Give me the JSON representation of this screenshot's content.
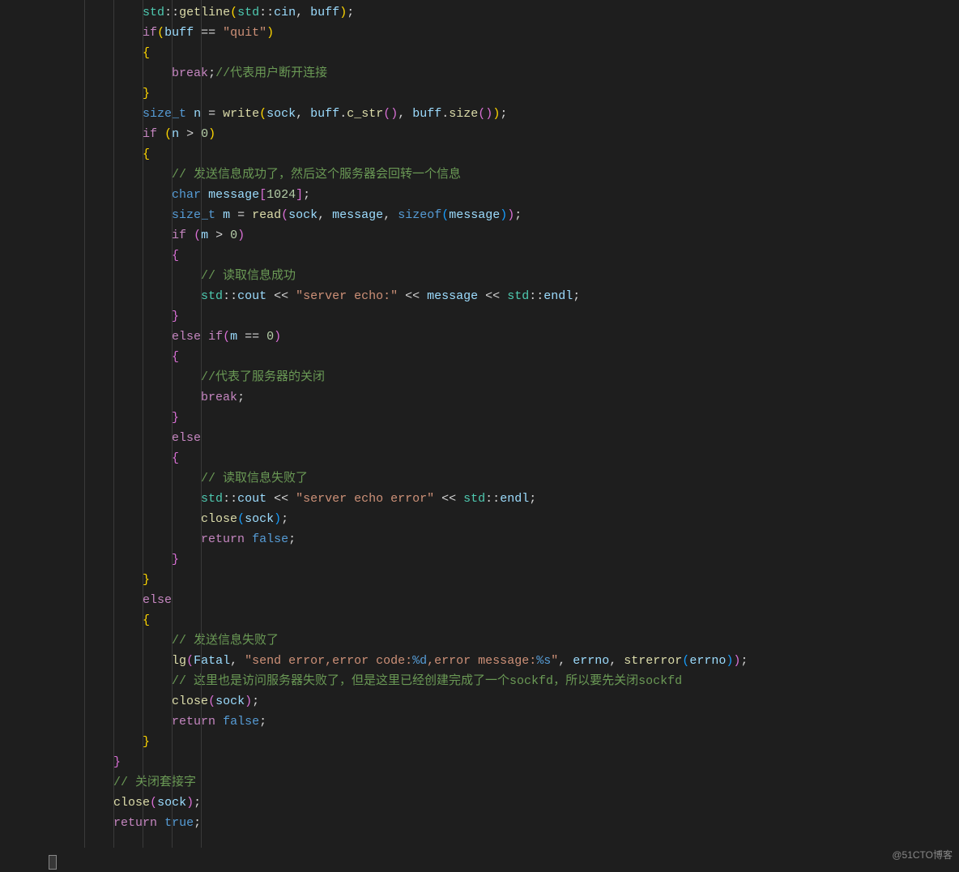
{
  "watermark": "@51CTO博客",
  "code": {
    "lines": [
      {
        "indent": 3,
        "tokens": [
          {
            "t": "namespace",
            "v": "std"
          },
          {
            "t": "operator",
            "v": "::"
          },
          {
            "t": "func",
            "v": "getline"
          },
          {
            "t": "paren-y",
            "v": "("
          },
          {
            "t": "namespace",
            "v": "std"
          },
          {
            "t": "operator",
            "v": "::"
          },
          {
            "t": "var",
            "v": "cin"
          },
          {
            "t": "operator",
            "v": ", "
          },
          {
            "t": "var",
            "v": "buff"
          },
          {
            "t": "paren-y",
            "v": ")"
          },
          {
            "t": "operator",
            "v": ";"
          }
        ]
      },
      {
        "indent": 3,
        "tokens": [
          {
            "t": "keyword",
            "v": "if"
          },
          {
            "t": "paren-y",
            "v": "("
          },
          {
            "t": "var",
            "v": "buff"
          },
          {
            "t": "operator",
            "v": " == "
          },
          {
            "t": "string",
            "v": "\"quit\""
          },
          {
            "t": "paren-y",
            "v": ")"
          }
        ]
      },
      {
        "indent": 3,
        "tokens": [
          {
            "t": "paren-y",
            "v": "{"
          }
        ]
      },
      {
        "indent": 4,
        "tokens": [
          {
            "t": "keyword",
            "v": "break"
          },
          {
            "t": "operator",
            "v": ";"
          },
          {
            "t": "comment",
            "v": "//代表用户断开连接"
          }
        ]
      },
      {
        "indent": 3,
        "tokens": [
          {
            "t": "paren-y",
            "v": "}"
          }
        ]
      },
      {
        "indent": 3,
        "tokens": [
          {
            "t": "type",
            "v": "size_t"
          },
          {
            "t": "operator",
            "v": " "
          },
          {
            "t": "var",
            "v": "n"
          },
          {
            "t": "operator",
            "v": " = "
          },
          {
            "t": "func",
            "v": "write"
          },
          {
            "t": "paren-y",
            "v": "("
          },
          {
            "t": "var",
            "v": "sock"
          },
          {
            "t": "operator",
            "v": ", "
          },
          {
            "t": "var",
            "v": "buff"
          },
          {
            "t": "operator",
            "v": "."
          },
          {
            "t": "func",
            "v": "c_str"
          },
          {
            "t": "paren-m",
            "v": "()"
          },
          {
            "t": "operator",
            "v": ", "
          },
          {
            "t": "var",
            "v": "buff"
          },
          {
            "t": "operator",
            "v": "."
          },
          {
            "t": "func",
            "v": "size"
          },
          {
            "t": "paren-m",
            "v": "()"
          },
          {
            "t": "paren-y",
            "v": ")"
          },
          {
            "t": "operator",
            "v": ";"
          }
        ]
      },
      {
        "indent": 3,
        "tokens": [
          {
            "t": "keyword",
            "v": "if"
          },
          {
            "t": "operator",
            "v": " "
          },
          {
            "t": "paren-y",
            "v": "("
          },
          {
            "t": "var",
            "v": "n"
          },
          {
            "t": "operator",
            "v": " > "
          },
          {
            "t": "number",
            "v": "0"
          },
          {
            "t": "paren-y",
            "v": ")"
          }
        ]
      },
      {
        "indent": 3,
        "tokens": [
          {
            "t": "paren-y",
            "v": "{"
          }
        ]
      },
      {
        "indent": 4,
        "tokens": [
          {
            "t": "comment",
            "v": "// 发送信息成功了，然后这个服务器会回转一个信息"
          }
        ]
      },
      {
        "indent": 4,
        "tokens": [
          {
            "t": "type",
            "v": "char"
          },
          {
            "t": "operator",
            "v": " "
          },
          {
            "t": "var",
            "v": "message"
          },
          {
            "t": "paren-m",
            "v": "["
          },
          {
            "t": "number",
            "v": "1024"
          },
          {
            "t": "paren-m",
            "v": "]"
          },
          {
            "t": "operator",
            "v": ";"
          }
        ]
      },
      {
        "indent": 4,
        "tokens": [
          {
            "t": "type",
            "v": "size_t"
          },
          {
            "t": "operator",
            "v": " "
          },
          {
            "t": "var",
            "v": "m"
          },
          {
            "t": "operator",
            "v": " = "
          },
          {
            "t": "func",
            "v": "read"
          },
          {
            "t": "paren-m",
            "v": "("
          },
          {
            "t": "var",
            "v": "sock"
          },
          {
            "t": "operator",
            "v": ", "
          },
          {
            "t": "var",
            "v": "message"
          },
          {
            "t": "operator",
            "v": ", "
          },
          {
            "t": "type",
            "v": "sizeof"
          },
          {
            "t": "paren-b",
            "v": "("
          },
          {
            "t": "var",
            "v": "message"
          },
          {
            "t": "paren-b",
            "v": ")"
          },
          {
            "t": "paren-m",
            "v": ")"
          },
          {
            "t": "operator",
            "v": ";"
          }
        ]
      },
      {
        "indent": 4,
        "tokens": [
          {
            "t": "keyword",
            "v": "if"
          },
          {
            "t": "operator",
            "v": " "
          },
          {
            "t": "paren-m",
            "v": "("
          },
          {
            "t": "var",
            "v": "m"
          },
          {
            "t": "operator",
            "v": " > "
          },
          {
            "t": "number",
            "v": "0"
          },
          {
            "t": "paren-m",
            "v": ")"
          }
        ]
      },
      {
        "indent": 4,
        "tokens": [
          {
            "t": "paren-m",
            "v": "{"
          }
        ]
      },
      {
        "indent": 5,
        "tokens": [
          {
            "t": "comment",
            "v": "// 读取信息成功"
          }
        ]
      },
      {
        "indent": 5,
        "tokens": [
          {
            "t": "namespace",
            "v": "std"
          },
          {
            "t": "operator",
            "v": "::"
          },
          {
            "t": "var",
            "v": "cout"
          },
          {
            "t": "operator",
            "v": " << "
          },
          {
            "t": "string",
            "v": "\"server echo:\""
          },
          {
            "t": "operator",
            "v": " << "
          },
          {
            "t": "var",
            "v": "message"
          },
          {
            "t": "operator",
            "v": " << "
          },
          {
            "t": "namespace",
            "v": "std"
          },
          {
            "t": "operator",
            "v": "::"
          },
          {
            "t": "var",
            "v": "endl"
          },
          {
            "t": "operator",
            "v": ";"
          }
        ]
      },
      {
        "indent": 4,
        "tokens": [
          {
            "t": "paren-m",
            "v": "}"
          }
        ]
      },
      {
        "indent": 4,
        "tokens": [
          {
            "t": "keyword",
            "v": "else"
          },
          {
            "t": "operator",
            "v": " "
          },
          {
            "t": "keyword",
            "v": "if"
          },
          {
            "t": "paren-m",
            "v": "("
          },
          {
            "t": "var",
            "v": "m"
          },
          {
            "t": "operator",
            "v": " == "
          },
          {
            "t": "number",
            "v": "0"
          },
          {
            "t": "paren-m",
            "v": ")"
          }
        ]
      },
      {
        "indent": 4,
        "tokens": [
          {
            "t": "paren-m",
            "v": "{"
          }
        ]
      },
      {
        "indent": 5,
        "tokens": [
          {
            "t": "comment",
            "v": "//代表了服务器的关闭"
          }
        ]
      },
      {
        "indent": 5,
        "tokens": [
          {
            "t": "keyword",
            "v": "break"
          },
          {
            "t": "operator",
            "v": ";"
          }
        ]
      },
      {
        "indent": 4,
        "tokens": [
          {
            "t": "paren-m",
            "v": "}"
          }
        ]
      },
      {
        "indent": 4,
        "tokens": [
          {
            "t": "keyword",
            "v": "else"
          }
        ]
      },
      {
        "indent": 4,
        "tokens": [
          {
            "t": "paren-m",
            "v": "{"
          }
        ]
      },
      {
        "indent": 5,
        "tokens": [
          {
            "t": "comment",
            "v": "// 读取信息失败了"
          }
        ]
      },
      {
        "indent": 5,
        "tokens": [
          {
            "t": "namespace",
            "v": "std"
          },
          {
            "t": "operator",
            "v": "::"
          },
          {
            "t": "var",
            "v": "cout"
          },
          {
            "t": "operator",
            "v": " << "
          },
          {
            "t": "string",
            "v": "\"server echo error\""
          },
          {
            "t": "operator",
            "v": " << "
          },
          {
            "t": "namespace",
            "v": "std"
          },
          {
            "t": "operator",
            "v": "::"
          },
          {
            "t": "var",
            "v": "endl"
          },
          {
            "t": "operator",
            "v": ";"
          }
        ]
      },
      {
        "indent": 5,
        "tokens": [
          {
            "t": "func",
            "v": "close"
          },
          {
            "t": "paren-b",
            "v": "("
          },
          {
            "t": "var",
            "v": "sock"
          },
          {
            "t": "paren-b",
            "v": ")"
          },
          {
            "t": "operator",
            "v": ";"
          }
        ]
      },
      {
        "indent": 5,
        "tokens": [
          {
            "t": "keyword",
            "v": "return"
          },
          {
            "t": "operator",
            "v": " "
          },
          {
            "t": "type",
            "v": "false"
          },
          {
            "t": "operator",
            "v": ";"
          }
        ]
      },
      {
        "indent": 4,
        "tokens": [
          {
            "t": "paren-m",
            "v": "}"
          }
        ]
      },
      {
        "indent": 3,
        "tokens": [
          {
            "t": "paren-y",
            "v": "}"
          }
        ]
      },
      {
        "indent": 3,
        "tokens": [
          {
            "t": "keyword",
            "v": "else"
          }
        ]
      },
      {
        "indent": 3,
        "tokens": [
          {
            "t": "paren-y",
            "v": "{"
          }
        ]
      },
      {
        "indent": 4,
        "tokens": [
          {
            "t": "comment",
            "v": "// 发送信息失败了"
          }
        ]
      },
      {
        "indent": 4,
        "tokens": [
          {
            "t": "func",
            "v": "lg"
          },
          {
            "t": "paren-m",
            "v": "("
          },
          {
            "t": "var",
            "v": "Fatal"
          },
          {
            "t": "operator",
            "v": ", "
          },
          {
            "t": "string",
            "v": "\"send error,error code:"
          },
          {
            "t": "type",
            "v": "%d"
          },
          {
            "t": "string",
            "v": ",error message:"
          },
          {
            "t": "type",
            "v": "%s"
          },
          {
            "t": "string",
            "v": "\""
          },
          {
            "t": "operator",
            "v": ", "
          },
          {
            "t": "var",
            "v": "errno"
          },
          {
            "t": "operator",
            "v": ", "
          },
          {
            "t": "func",
            "v": "strerror"
          },
          {
            "t": "paren-b",
            "v": "("
          },
          {
            "t": "var",
            "v": "errno"
          },
          {
            "t": "paren-b",
            "v": ")"
          },
          {
            "t": "paren-m",
            "v": ")"
          },
          {
            "t": "operator",
            "v": ";"
          }
        ]
      },
      {
        "indent": 4,
        "tokens": [
          {
            "t": "comment",
            "v": "// 这里也是访问服务器失败了，但是这里已经创建完成了一个sockfd，所以要先关闭sockfd"
          }
        ]
      },
      {
        "indent": 4,
        "tokens": [
          {
            "t": "func",
            "v": "close"
          },
          {
            "t": "paren-m",
            "v": "("
          },
          {
            "t": "var",
            "v": "sock"
          },
          {
            "t": "paren-m",
            "v": ")"
          },
          {
            "t": "operator",
            "v": ";"
          }
        ]
      },
      {
        "indent": 4,
        "tokens": [
          {
            "t": "keyword",
            "v": "return"
          },
          {
            "t": "operator",
            "v": " "
          },
          {
            "t": "type",
            "v": "false"
          },
          {
            "t": "operator",
            "v": ";"
          }
        ]
      },
      {
        "indent": 3,
        "tokens": [
          {
            "t": "paren-y",
            "v": "}"
          }
        ]
      },
      {
        "indent": 2,
        "tokens": [
          {
            "t": "paren-m",
            "v": "}"
          }
        ]
      },
      {
        "indent": 2,
        "tokens": [
          {
            "t": "comment",
            "v": "// 关闭套接字"
          }
        ]
      },
      {
        "indent": 2,
        "tokens": [
          {
            "t": "func",
            "v": "close"
          },
          {
            "t": "paren-m",
            "v": "("
          },
          {
            "t": "var",
            "v": "sock"
          },
          {
            "t": "paren-m",
            "v": ")"
          },
          {
            "t": "operator",
            "v": ";"
          }
        ]
      },
      {
        "indent": 2,
        "tokens": [
          {
            "t": "keyword",
            "v": "return"
          },
          {
            "t": "operator",
            "v": " "
          },
          {
            "t": "type",
            "v": "true"
          },
          {
            "t": "operator",
            "v": ";"
          }
        ]
      },
      {
        "indent": 0,
        "tokens": []
      }
    ]
  }
}
